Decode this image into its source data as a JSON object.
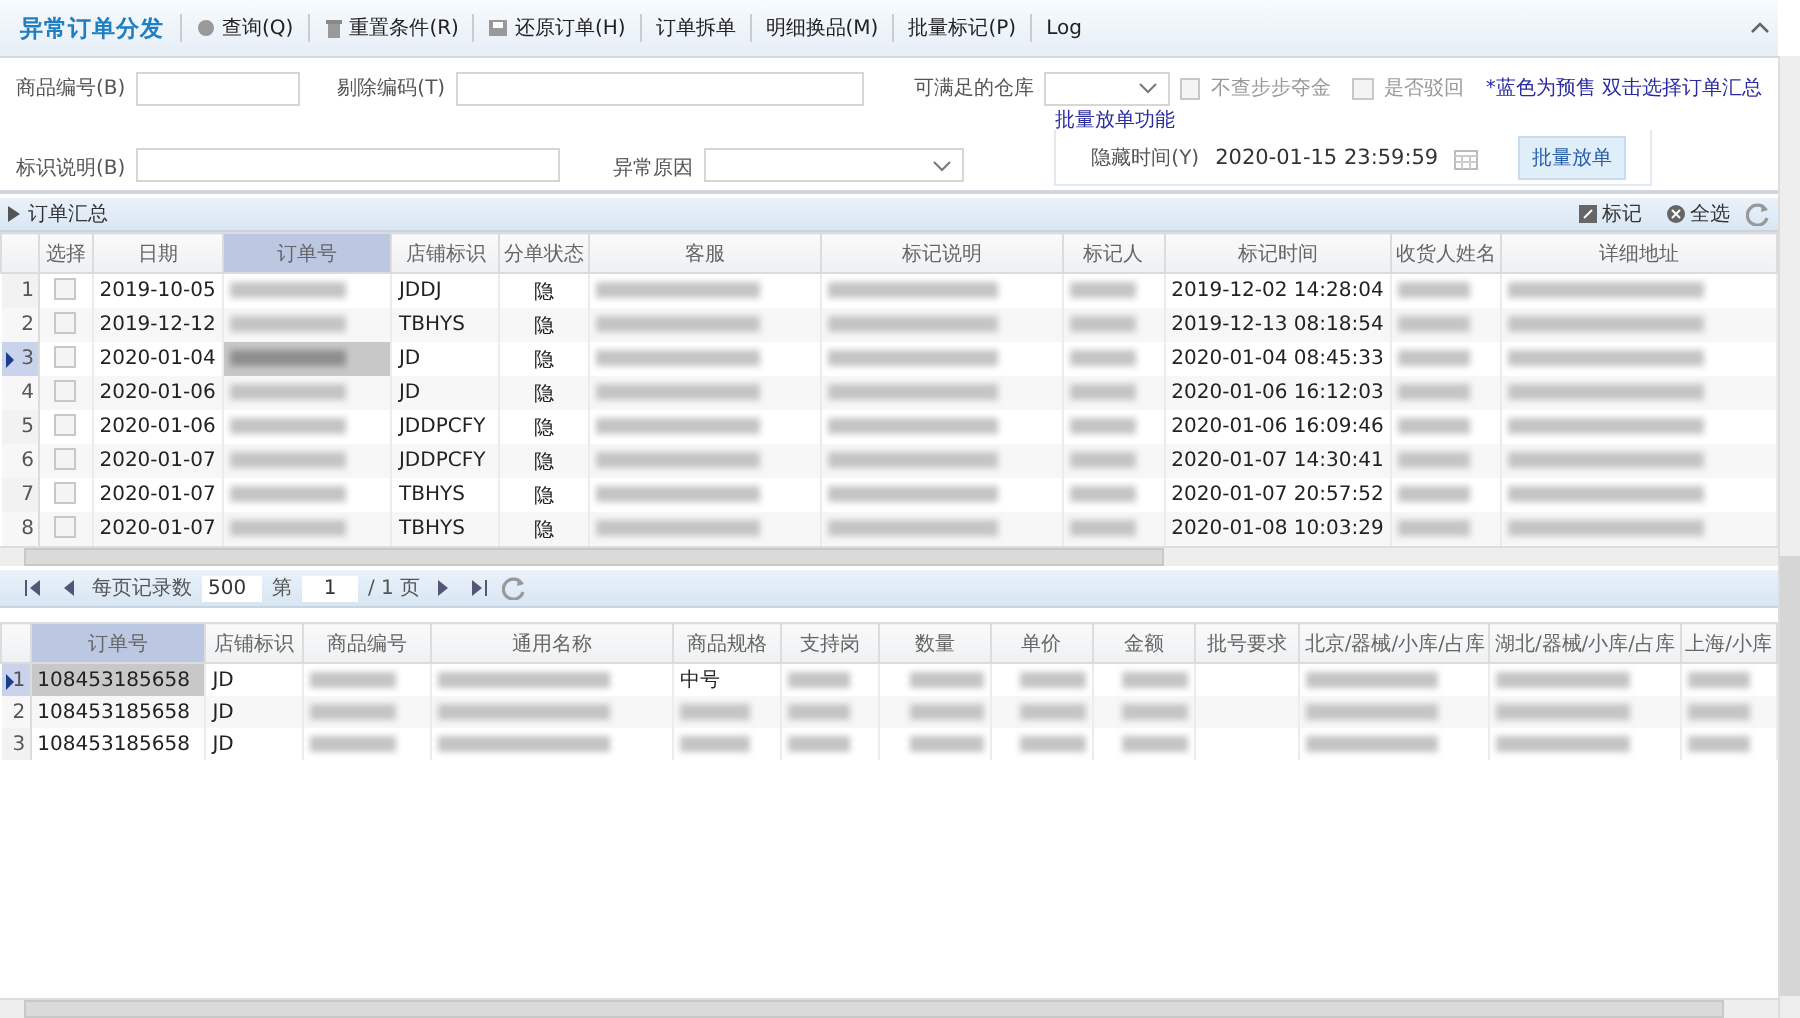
{
  "toolbar": {
    "title": "异常订单分发",
    "buttons": [
      {
        "label": "查询(Q)",
        "kind": "search"
      },
      {
        "label": "重置条件(R)",
        "kind": "trash"
      },
      {
        "label": "还原订单(H)",
        "kind": "save"
      },
      {
        "label": "订单拆单",
        "kind": "plain"
      },
      {
        "label": "明细换品(M)",
        "kind": "plain"
      },
      {
        "label": "批量标记(P)",
        "kind": "plain"
      },
      {
        "label": "Log",
        "kind": "plain"
      }
    ]
  },
  "filters": {
    "product_code": {
      "label": "商品编号(B)"
    },
    "exclude_code": {
      "label": "剔除编码(T)"
    },
    "warehouse": {
      "label": "可满足的仓库"
    },
    "checkboxes": [
      {
        "label": "不查步步夺金",
        "checked": false
      },
      {
        "label": "是否驳回",
        "checked": false
      }
    ],
    "note": "*蓝色为预售 双击选择订单汇总",
    "mark_note": {
      "label": "标识说明(B)"
    },
    "reason": {
      "label": "异常原因"
    },
    "batch": {
      "title": "批量放单功能",
      "time_label": "隐藏时间(Y)",
      "time_value": "2020-01-15 23:59:59",
      "button": "批量放单"
    }
  },
  "orders": {
    "title": "订单汇总",
    "actions": [
      {
        "label": "标记",
        "kind": "mark"
      },
      {
        "label": "全选",
        "kind": "select-all"
      }
    ],
    "columns": [
      "选择",
      "日期",
      "订单号",
      "店铺标识",
      "分单状态",
      "客服",
      "标记说明",
      "标记人",
      "标记时间",
      "收货人姓名",
      "详细地址"
    ],
    "rows": [
      {
        "number": "1",
        "selected": false,
        "cells": [
          {
            "kind": "checkbox",
            "checked": false
          },
          "2019-10-05",
          {
            "kind": "blurred"
          },
          "JDDJ",
          "隐",
          {
            "kind": "blurred"
          },
          {
            "kind": "blurred"
          },
          {
            "kind": "blurred"
          },
          "2019-12-02 14:28:04",
          {
            "kind": "blurred"
          },
          {
            "kind": "blurred"
          }
        ]
      },
      {
        "number": "2",
        "selected": false,
        "cells": [
          {
            "kind": "checkbox",
            "checked": false
          },
          "2019-12-12",
          {
            "kind": "blurred"
          },
          "TBHYS",
          "隐",
          {
            "kind": "blurred"
          },
          {
            "kind": "blurred"
          },
          {
            "kind": "blurred"
          },
          "2019-12-13 08:18:54",
          {
            "kind": "blurred"
          },
          {
            "kind": "blurred"
          }
        ]
      },
      {
        "number": "3",
        "selected": true,
        "cells": [
          {
            "kind": "checkbox",
            "checked": false
          },
          "2020-01-04",
          {
            "kind": "blurred"
          },
          "JD",
          "隐",
          {
            "kind": "blurred"
          },
          {
            "kind": "blurred"
          },
          {
            "kind": "blurred"
          },
          "2020-01-04 08:45:33",
          {
            "kind": "blurred"
          },
          {
            "kind": "blurred"
          }
        ]
      },
      {
        "number": "4",
        "selected": false,
        "cells": [
          {
            "kind": "checkbox",
            "checked": false
          },
          "2020-01-06",
          {
            "kind": "blurred"
          },
          "JD",
          "隐",
          {
            "kind": "blurred"
          },
          {
            "kind": "blurred"
          },
          {
            "kind": "blurred"
          },
          "2020-01-06 16:12:03",
          {
            "kind": "blurred"
          },
          {
            "kind": "blurred"
          }
        ]
      },
      {
        "number": "5",
        "selected": false,
        "cells": [
          {
            "kind": "checkbox",
            "checked": false
          },
          "2020-01-06",
          {
            "kind": "blurred"
          },
          "JDDPCFY",
          "隐",
          {
            "kind": "blurred"
          },
          {
            "kind": "blurred"
          },
          {
            "kind": "blurred"
          },
          "2020-01-06 16:09:46",
          {
            "kind": "blurred"
          },
          {
            "kind": "blurred"
          }
        ]
      },
      {
        "number": "6",
        "selected": false,
        "cells": [
          {
            "kind": "checkbox",
            "checked": false
          },
          "2020-01-07",
          {
            "kind": "blurred"
          },
          "JDDPCFY",
          "隐",
          {
            "kind": "blurred"
          },
          {
            "kind": "blurred"
          },
          {
            "kind": "blurred"
          },
          "2020-01-07 14:30:41",
          {
            "kind": "blurred"
          },
          {
            "kind": "blurred"
          }
        ]
      },
      {
        "number": "7",
        "selected": false,
        "cells": [
          {
            "kind": "checkbox",
            "checked": false
          },
          "2020-01-07",
          {
            "kind": "blurred"
          },
          "TBHYS",
          "隐",
          {
            "kind": "blurred"
          },
          {
            "kind": "blurred"
          },
          {
            "kind": "blurred"
          },
          "2020-01-07 20:57:52",
          {
            "kind": "blurred"
          },
          {
            "kind": "blurred"
          }
        ]
      },
      {
        "number": "8",
        "selected": false,
        "cells": [
          {
            "kind": "checkbox",
            "checked": false
          },
          "2020-01-07",
          {
            "kind": "blurred"
          },
          "TBHYS",
          "隐",
          {
            "kind": "blurred"
          },
          {
            "kind": "blurred"
          },
          {
            "kind": "blurred"
          },
          "2020-01-08 10:03:29",
          {
            "kind": "blurred"
          },
          {
            "kind": "blurred"
          }
        ]
      }
    ]
  },
  "pager": {
    "page_size_label": "每页记录数",
    "page_size": "500",
    "page_label": "第",
    "page": "1",
    "total": "/ 1 页"
  },
  "details": {
    "columns": [
      "订单号",
      "店铺标识",
      "商品编号",
      "通用名称",
      "商品规格",
      "支持岗",
      "数量",
      "单价",
      "金额",
      "批号要求",
      "北京/器械/小库/占库",
      "湖北/器械/小库/占库",
      "上海/小库"
    ],
    "rows": [
      {
        "number": "1",
        "selected": true,
        "cells": [
          "108453185658",
          "JD",
          {
            "kind": "blurred"
          },
          {
            "kind": "blurred"
          },
          "中号",
          {
            "kind": "blurred"
          },
          {
            "kind": "blurred"
          },
          {
            "kind": "blurred"
          },
          {
            "kind": "blurred"
          },
          null,
          {
            "kind": "blurred"
          },
          {
            "kind": "blurred"
          },
          {
            "kind": "blurred"
          }
        ]
      },
      {
        "number": "2",
        "selected": false,
        "cells": [
          "108453185658",
          "JD",
          {
            "kind": "blurred"
          },
          {
            "kind": "blurred"
          },
          {
            "kind": "blurred"
          },
          {
            "kind": "blurred"
          },
          {
            "kind": "blurred"
          },
          {
            "kind": "blurred"
          },
          {
            "kind": "blurred"
          },
          null,
          {
            "kind": "blurred"
          },
          {
            "kind": "blurred"
          },
          {
            "kind": "blurred"
          }
        ]
      },
      {
        "number": "3",
        "selected": false,
        "cells": [
          "108453185658",
          "JD",
          {
            "kind": "blurred"
          },
          {
            "kind": "blurred"
          },
          {
            "kind": "blurred"
          },
          {
            "kind": "blurred"
          },
          {
            "kind": "blurred"
          },
          {
            "kind": "blurred"
          },
          {
            "kind": "blurred"
          },
          null,
          {
            "kind": "blurred"
          },
          {
            "kind": "blurred"
          },
          {
            "kind": "blurred"
          }
        ]
      }
    ]
  }
}
